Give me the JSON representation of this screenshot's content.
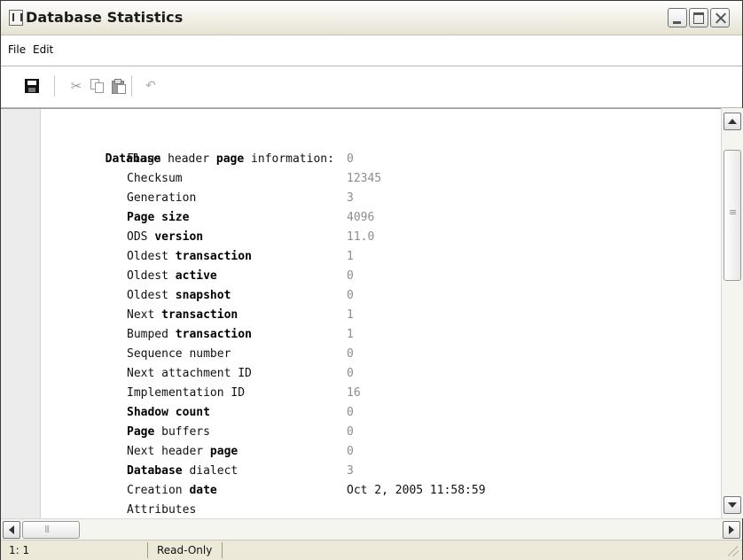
{
  "window": {
    "title": "Database Statistics",
    "icon": "document-icon"
  },
  "menu": {
    "file": "File",
    "edit": "Edit"
  },
  "toolbar": {
    "icons": [
      "save-icon",
      "cut-icon",
      "copy-icon",
      "paste-icon",
      "undo-icon"
    ]
  },
  "content": {
    "heading": {
      "segments": [
        {
          "text": "Database",
          "bold": true
        },
        {
          "text": " header ",
          "bold": false
        },
        {
          "text": "page",
          "bold": true
        },
        {
          "text": " information:",
          "bold": false
        }
      ]
    },
    "rows": [
      {
        "label_segments": [
          {
            "text": "Flags",
            "bold": false
          }
        ],
        "value": "0"
      },
      {
        "label_segments": [
          {
            "text": "Checksum",
            "bold": false
          }
        ],
        "value": "12345"
      },
      {
        "label_segments": [
          {
            "text": "Generation",
            "bold": false
          }
        ],
        "value": "3"
      },
      {
        "label_segments": [
          {
            "text": "Page size",
            "bold": true
          }
        ],
        "value": "4096"
      },
      {
        "label_segments": [
          {
            "text": "ODS ",
            "bold": false
          },
          {
            "text": "version",
            "bold": true
          }
        ],
        "value": "11.0"
      },
      {
        "label_segments": [
          {
            "text": "Oldest ",
            "bold": false
          },
          {
            "text": "transaction",
            "bold": true
          }
        ],
        "value": "1"
      },
      {
        "label_segments": [
          {
            "text": "Oldest ",
            "bold": false
          },
          {
            "text": "active",
            "bold": true
          }
        ],
        "value": "0"
      },
      {
        "label_segments": [
          {
            "text": "Oldest ",
            "bold": false
          },
          {
            "text": "snapshot",
            "bold": true
          }
        ],
        "value": "0"
      },
      {
        "label_segments": [
          {
            "text": "Next ",
            "bold": false
          },
          {
            "text": "transaction",
            "bold": true
          }
        ],
        "value": "1"
      },
      {
        "label_segments": [
          {
            "text": "Bumped ",
            "bold": false
          },
          {
            "text": "transaction",
            "bold": true
          }
        ],
        "value": "1"
      },
      {
        "label_segments": [
          {
            "text": "Sequence number",
            "bold": false
          }
        ],
        "value": "0"
      },
      {
        "label_segments": [
          {
            "text": "Next attachment ID",
            "bold": false
          }
        ],
        "value": "0"
      },
      {
        "label_segments": [
          {
            "text": "Implementation ID",
            "bold": false
          }
        ],
        "value": "16"
      },
      {
        "label_segments": [
          {
            "text": "Shadow count",
            "bold": true
          }
        ],
        "value": "0"
      },
      {
        "label_segments": [
          {
            "text": "Page",
            "bold": true
          },
          {
            "text": " buffers",
            "bold": false
          }
        ],
        "value": "0"
      },
      {
        "label_segments": [
          {
            "text": "Next header ",
            "bold": false
          },
          {
            "text": "page",
            "bold": true
          }
        ],
        "value": "0"
      },
      {
        "label_segments": [
          {
            "text": "Database",
            "bold": true
          },
          {
            "text": " dialect",
            "bold": false
          }
        ],
        "value": "3"
      },
      {
        "label_segments": [
          {
            "text": "Creation ",
            "bold": false
          },
          {
            "text": "date",
            "bold": true
          }
        ],
        "value": "Oct 2, 2005 11:58:59"
      },
      {
        "label_segments": [
          {
            "text": "Attributes",
            "bold": false
          }
        ],
        "value": ""
      }
    ]
  },
  "status": {
    "position": "1: 1",
    "mode": "Read-Only"
  },
  "colors": {
    "value_text": "#8c8c8c",
    "gutter": "#ececec"
  }
}
